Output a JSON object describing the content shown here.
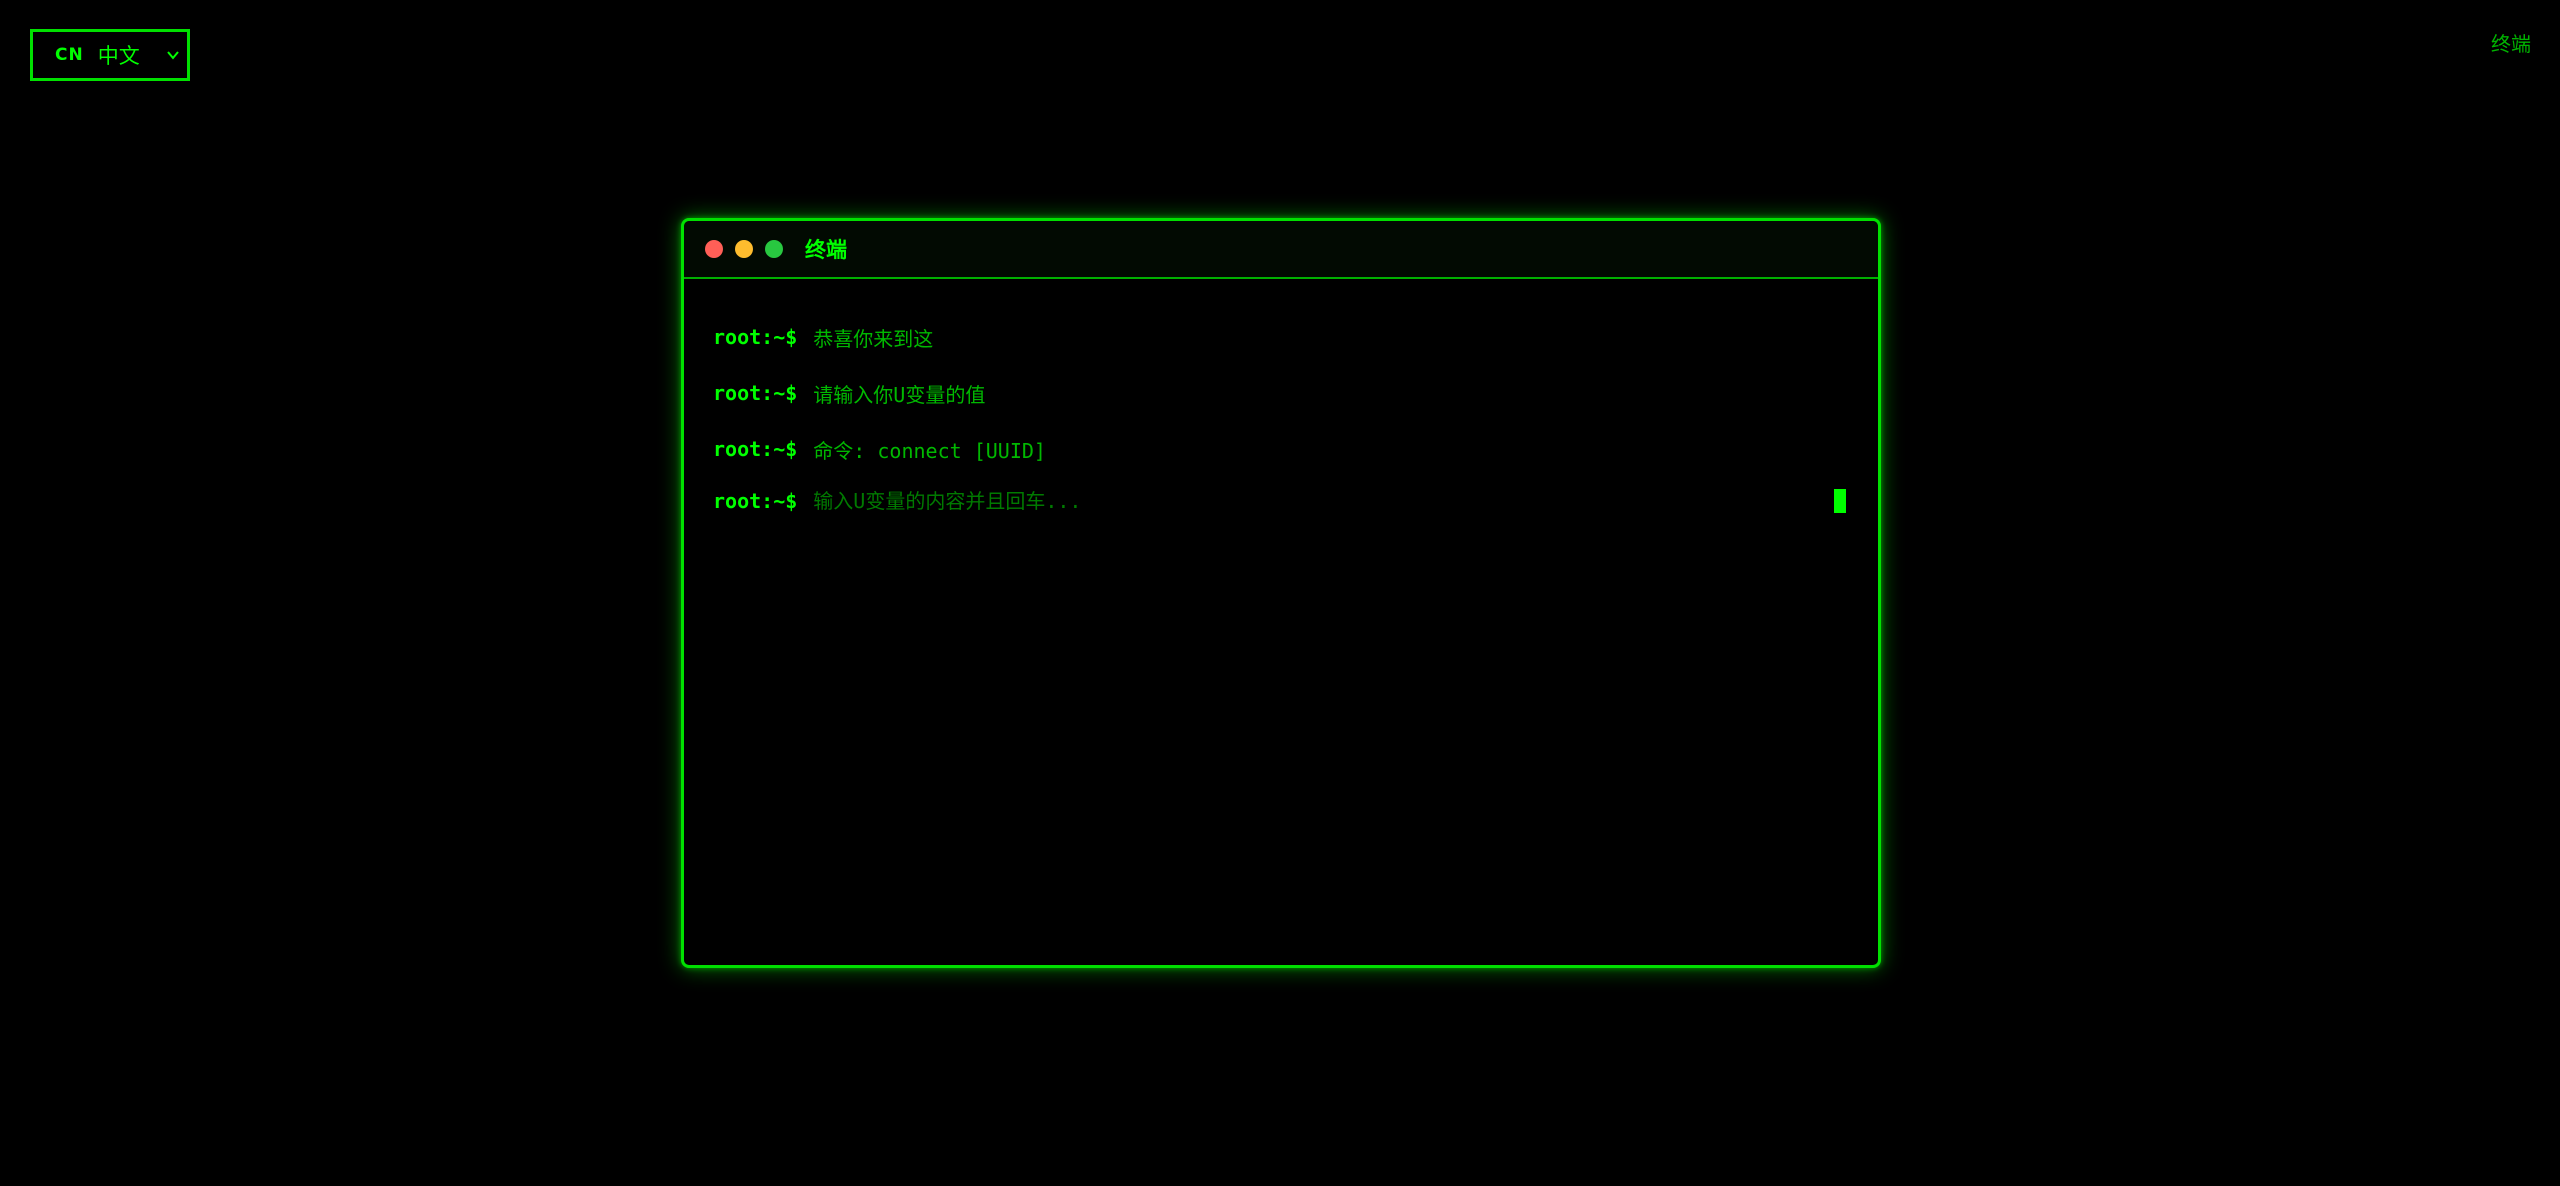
{
  "language_selector": {
    "flag": "CN",
    "label": "中文"
  },
  "top_right_link": "终端",
  "terminal": {
    "title": "终端",
    "prompt": "root:~$",
    "lines": [
      "恭喜你来到这",
      "请输入你U变量的值",
      "命令: connect [UUID]"
    ],
    "input": {
      "value": "",
      "placeholder": "输入U变量的内容并且回车..."
    }
  },
  "colors": {
    "accent": "#00ff00",
    "dim_text": "#00b800",
    "background": "#000000",
    "close": "#ff5f57",
    "minimize": "#febc2e",
    "maximize": "#28c840"
  }
}
